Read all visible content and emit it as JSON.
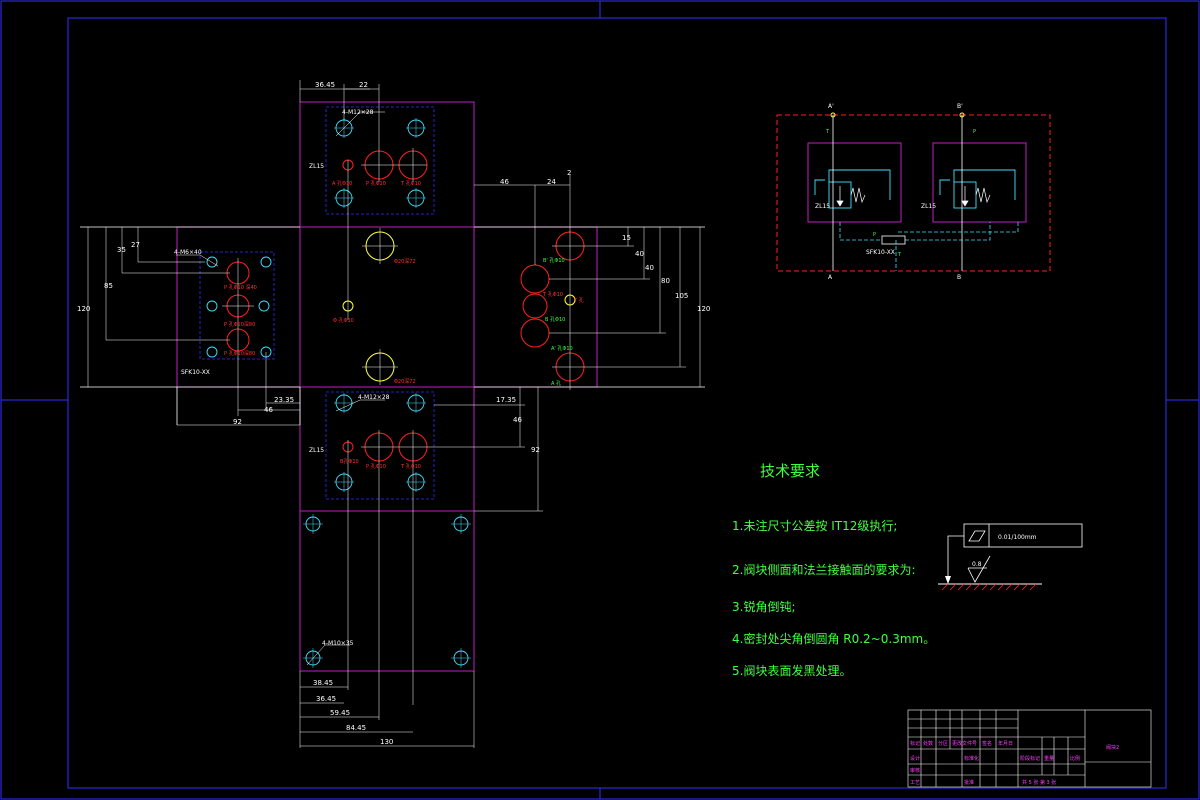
{
  "colors": {
    "background": "#000000",
    "frame": "#3030ff",
    "block_outline": "#c020c0",
    "port_circle": "#ff2020",
    "bolt_circle": "#40e0ff",
    "center_circle": "#ffff40",
    "text_green": "#40ff40",
    "dim_white": "#ffffff",
    "hydraulic_red": "#ff2020",
    "hydraulic_cyan": "#40e0ff"
  },
  "top_block": {
    "dim_a": "36.45",
    "dim_b": "22",
    "thread": "4-M12×28",
    "valve": "ZL15",
    "port_p": "P 孔Φ10",
    "port_t": "T 孔Φ10",
    "port_a": "A 孔Φ10"
  },
  "center_block": {
    "hole_top": "Φ20深72",
    "hole_bottom": "Φ20深72",
    "hole_mid": "Φ 孔Φ10"
  },
  "left_block": {
    "thread": "4-M6×40",
    "label": "SFK10-XX",
    "port_1": "P 孔Φ10 深40",
    "port_2": "P 孔Φ10深80",
    "port_3": "P 孔Φ10深80",
    "dim_35": "35",
    "dim_27": "27",
    "dim_85": "85",
    "dim_120": "120",
    "dim_2335": "23.35",
    "dim_46": "46",
    "dim_92": "92"
  },
  "right_block": {
    "dim_46": "46",
    "dim_24": "24",
    "dim_2": "2",
    "dim_15": "15",
    "dim_40a": "40",
    "dim_40b": "40",
    "dim_80": "80",
    "dim_105": "105",
    "dim_120": "120",
    "port_b": "B' 孔Φ10",
    "port_t1": "T 孔Φ10",
    "port_t2": "T 孔",
    "port_b2": "B 孔Φ10",
    "port_a2": "A' 孔Φ10",
    "port_a3": "A 孔"
  },
  "bottom_block": {
    "thread": "4-M12×28",
    "valve": "ZL15",
    "dim_1735": "17.35",
    "dim_46": "46",
    "dim_92": "92",
    "port_p": "P 孔Φ10",
    "port_t": "T 孔Φ10",
    "port_x": "B孔Φ10"
  },
  "flange_block": {
    "thread": "4-M10×35",
    "dims": [
      "38.45",
      "36.45",
      "59.45",
      "84.45",
      "130"
    ]
  },
  "schematic": {
    "valve1": "ZL15",
    "valve2": "ZL15",
    "check_valve": "SFK10-XX",
    "ports_top": [
      "A'",
      "B'"
    ],
    "ports_bottom": [
      "A",
      "B"
    ],
    "labels_t": [
      "T",
      "T"
    ],
    "labels_p": [
      "P",
      "P"
    ]
  },
  "requirements": {
    "title": "技术要求",
    "items": [
      "1.未注尺寸公差按 IT12级执行;",
      "2.阀块侧面和法兰接触面的要求为:",
      "3.锐角倒钝;",
      "4.密封处尖角倒圆角 R0.2~0.3mm。",
      "5.阀块表面发黑处理。"
    ]
  },
  "tolerance": {
    "value": "0.01/100mm",
    "roughness": "0.8"
  },
  "title_block": {
    "drawing_name": "阀块2",
    "sheet": "共 5 张 第 3 张",
    "cells": [
      "标记",
      "处数",
      "分区",
      "更改文件号",
      "签名",
      "年月日",
      "设计",
      "标准化",
      "阶段标记",
      "重量",
      "比例",
      "审核",
      "工艺",
      "批准"
    ]
  }
}
